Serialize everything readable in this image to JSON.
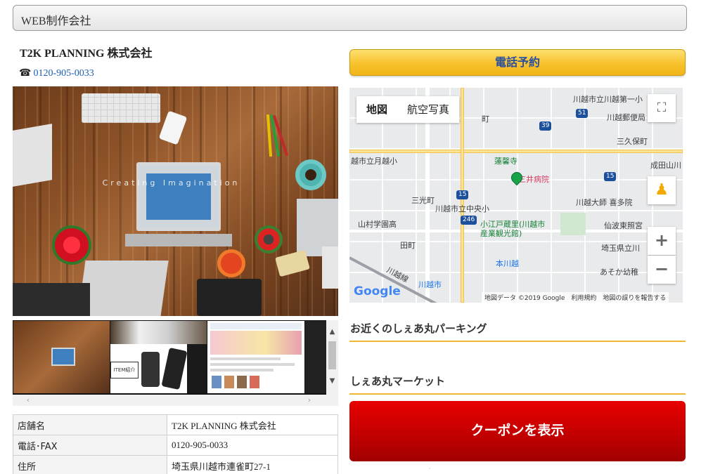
{
  "category": "WEB制作会社",
  "shop": {
    "name": "T2K PLANNING 株式会社",
    "phone": "0120-905-0033"
  },
  "photo": {
    "overlay_text": "Creating Imagination"
  },
  "thumbnails": {
    "t2_box_text": "ITEM紹介"
  },
  "info_table": [
    {
      "key": "店舗名",
      "value": "T2K PLANNING 株式会社"
    },
    {
      "key": "電話･FAX",
      "value": "0120-905-0033"
    },
    {
      "key": "住所",
      "value": "埼玉県川越市連雀町27-1"
    }
  ],
  "buttons": {
    "call": "電話予約",
    "coupon": "クーポンを表示"
  },
  "map": {
    "tab_map": "地図",
    "tab_satellite": "航空写真",
    "attribution": "地図データ ©2019 Google　利用規約　地図の誤りを報告する",
    "google_logo": "Google",
    "labels": [
      "川越市立川越第一小",
      "川越郵便局",
      "三久保町",
      "成田山川",
      "越市立月越小",
      "蓮馨寺",
      "三井病院",
      "三光町",
      "川越市立中央小",
      "川越大師 喜多院",
      "山村学園高",
      "小江戸蔵里(川越市産業観光館)",
      "仙波東照宮",
      "田町",
      "埼玉県立川",
      "本川越",
      "あそか幼稚",
      "川越線",
      "川越市",
      "町"
    ],
    "shields": [
      "51",
      "39",
      "15",
      "15",
      "246"
    ]
  },
  "links": [
    "お近くのしぇあ丸パーキング",
    "しぇあ丸マーケット"
  ]
}
